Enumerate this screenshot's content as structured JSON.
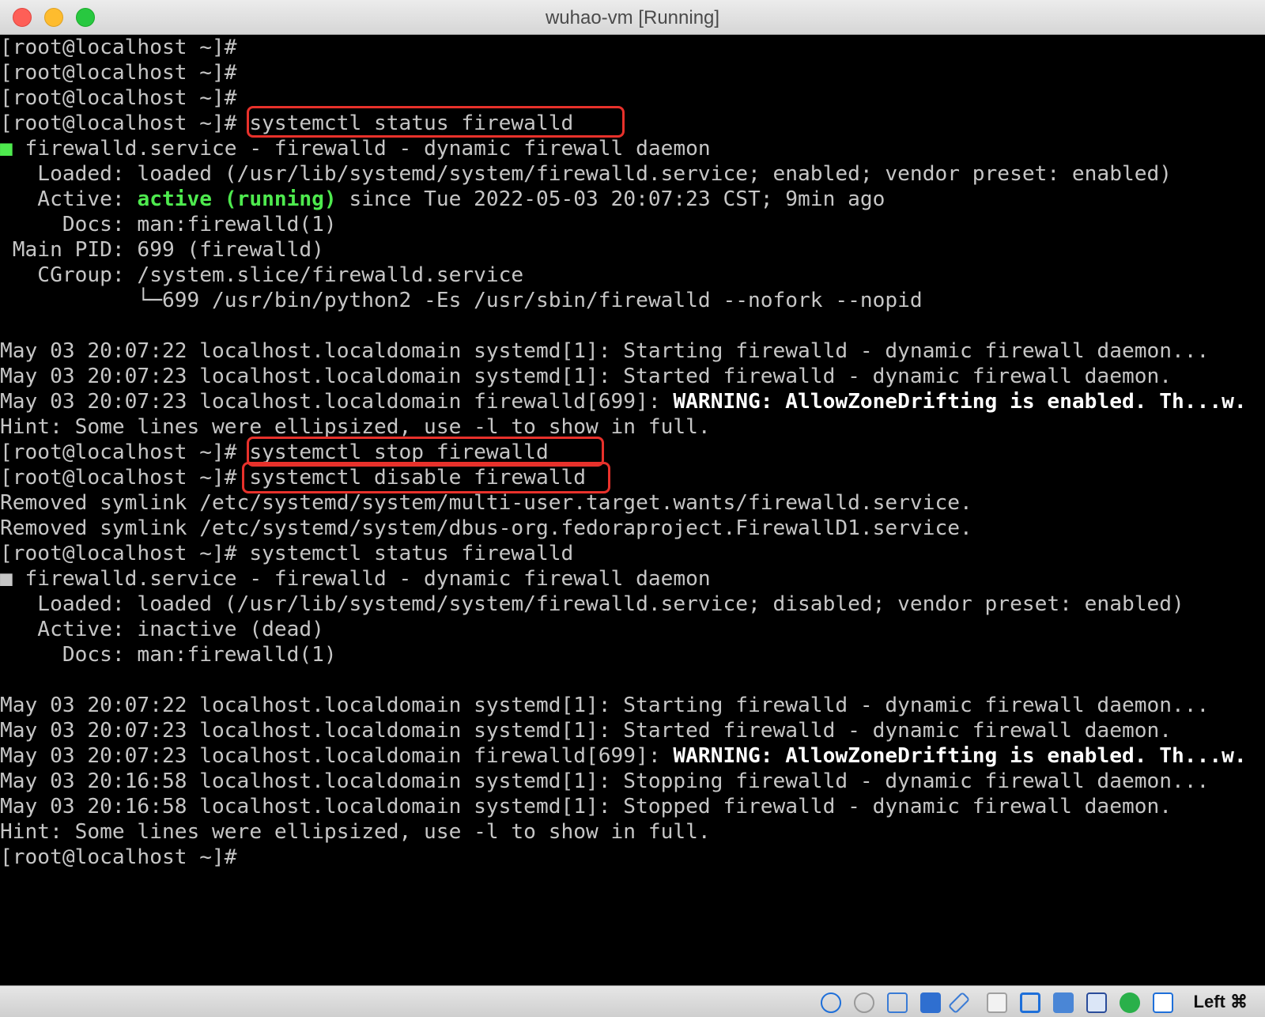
{
  "window": {
    "title": "wuhao-vm [Running]"
  },
  "terminal": {
    "lines": [
      "[root@localhost ~]#",
      "[root@localhost ~]#",
      "[root@localhost ~]#",
      "[root@localhost ~]# systemctl status firewalld",
      "■ firewalld.service - firewalld - dynamic firewall daemon",
      "   Loaded: loaded (/usr/lib/systemd/system/firewalld.service; enabled; vendor preset: enabled)",
      "   Active: active (running) since Tue 2022-05-03 20:07:23 CST; 9min ago",
      "     Docs: man:firewalld(1)",
      " Main PID: 699 (firewalld)",
      "   CGroup: /system.slice/firewalld.service",
      "           └─699 /usr/bin/python2 -Es /usr/sbin/firewalld --nofork --nopid",
      "",
      "May 03 20:07:22 localhost.localdomain systemd[1]: Starting firewalld - dynamic firewall daemon...",
      "May 03 20:07:23 localhost.localdomain systemd[1]: Started firewalld - dynamic firewall daemon.",
      "May 03 20:07:23 localhost.localdomain firewalld[699]: WARNING: AllowZoneDrifting is enabled. Th...w.",
      "Hint: Some lines were ellipsized, use -l to show in full.",
      "[root@localhost ~]# systemctl stop firewalld",
      "[root@localhost ~]# systemctl disable firewalld",
      "Removed symlink /etc/systemd/system/multi-user.target.wants/firewalld.service.",
      "Removed symlink /etc/systemd/system/dbus-org.fedoraproject.FirewallD1.service.",
      "[root@localhost ~]# systemctl status firewalld",
      "■ firewalld.service - firewalld - dynamic firewall daemon",
      "   Loaded: loaded (/usr/lib/systemd/system/firewalld.service; disabled; vendor preset: enabled)",
      "   Active: inactive (dead)",
      "     Docs: man:firewalld(1)",
      "",
      "May 03 20:07:22 localhost.localdomain systemd[1]: Starting firewalld - dynamic firewall daemon...",
      "May 03 20:07:23 localhost.localdomain systemd[1]: Started firewalld - dynamic firewall daemon.",
      "May 03 20:07:23 localhost.localdomain firewalld[699]: WARNING: AllowZoneDrifting is enabled. Th...w.",
      "May 03 20:16:58 localhost.localdomain systemd[1]: Stopping firewalld - dynamic firewall daemon...",
      "May 03 20:16:58 localhost.localdomain systemd[1]: Stopped firewalld - dynamic firewall daemon.",
      "Hint: Some lines were ellipsized, use -l to show in full.",
      "[root@localhost ~]#"
    ]
  },
  "statusbar": {
    "icons": [
      "help-icon",
      "optical-drive-icon",
      "audio-icon",
      "network-icon",
      "usb-icon",
      "shared-folder-icon",
      "display-icon",
      "recording-icon",
      "cpu-icon",
      "mouse-integration-icon",
      "download-icon"
    ],
    "host_key": "Left ⌘"
  },
  "colors": {
    "highlight_box": "#e8312b",
    "active_green": "#4eea4e",
    "terminal_text": "#c6c6c6",
    "terminal_bg": "#000000"
  }
}
